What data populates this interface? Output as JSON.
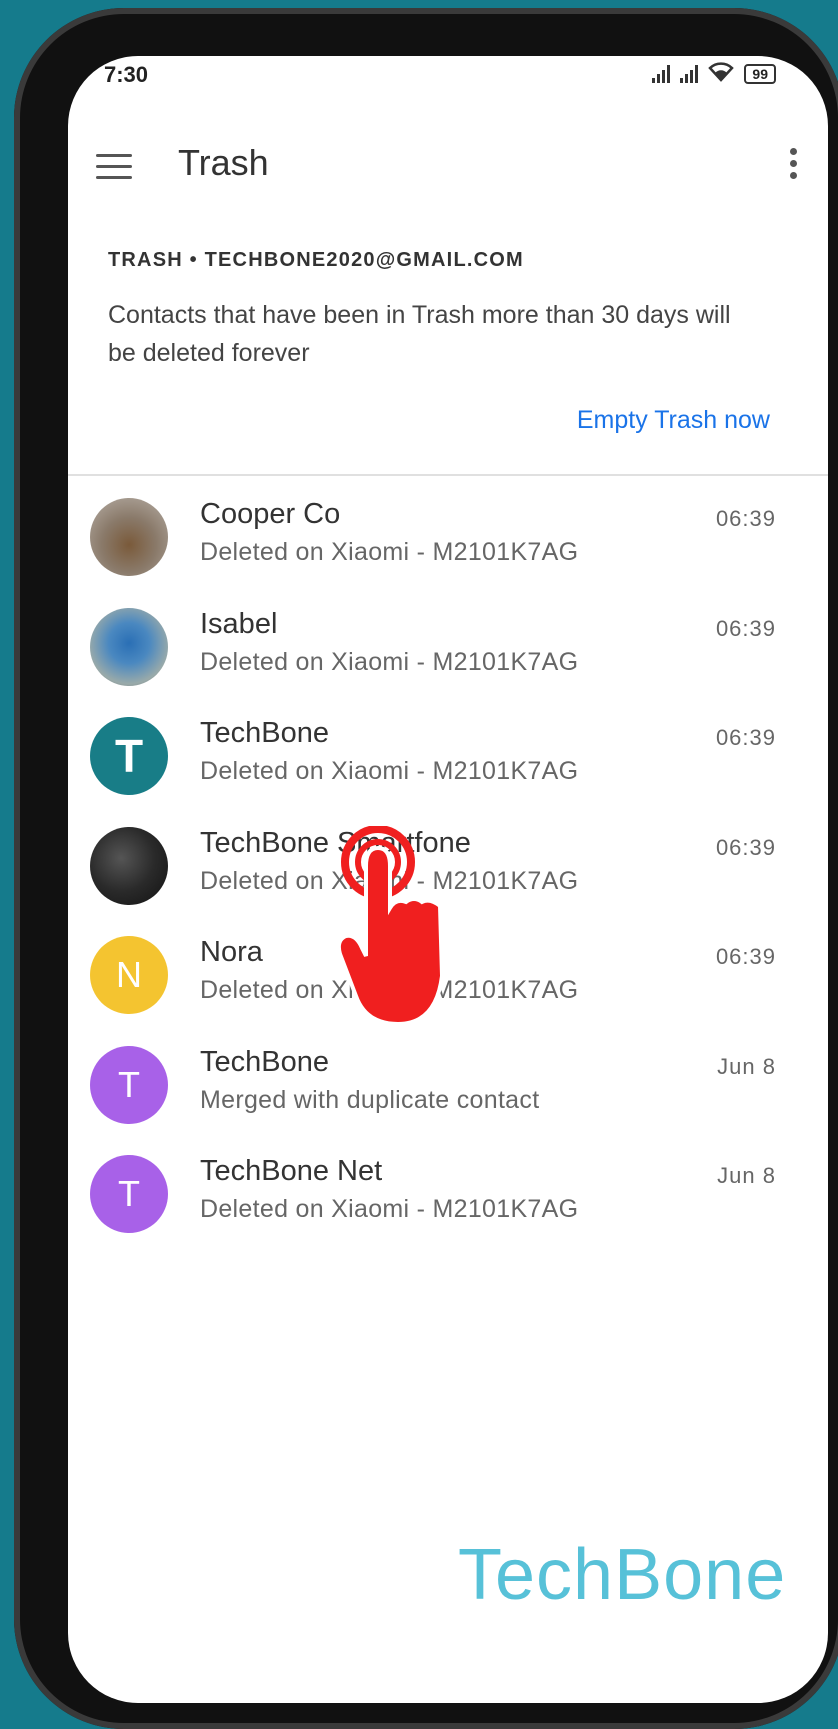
{
  "status_bar": {
    "time": "7:30",
    "battery": "99"
  },
  "app_bar": {
    "title": "Trash"
  },
  "account_label": "TRASH • TECHBONE2020@GMAIL.COM",
  "info_text": "Contacts that have been in Trash more than 30 days will be deleted forever",
  "empty_trash_label": "Empty Trash now",
  "contacts": [
    {
      "name": "Cooper Co",
      "subtitle": "Deleted on Xiaomi - M2101K7AG",
      "time": "06:39",
      "avatar_letter": "",
      "avatar_color": "#8a7a6a"
    },
    {
      "name": "Isabel",
      "subtitle": "Deleted on Xiaomi - M2101K7AG",
      "time": "06:39",
      "avatar_letter": "",
      "avatar_color": "#6b8fb0"
    },
    {
      "name": "TechBone",
      "subtitle": "Deleted on Xiaomi - M2101K7AG",
      "time": "06:39",
      "avatar_letter": "T",
      "avatar_color": "#187d87"
    },
    {
      "name": "TechBone Smartfone",
      "subtitle": "Deleted on Xiaomi - M2101K7AG",
      "time": "06:39",
      "avatar_letter": "",
      "avatar_color": "#2a2a2a"
    },
    {
      "name": "Nora",
      "subtitle": "Deleted on Xiaomi - M2101K7AG",
      "time": "06:39",
      "avatar_letter": "N",
      "avatar_color": "#f4c430"
    },
    {
      "name": "TechBone",
      "subtitle": "Merged with duplicate contact",
      "time": "Jun 8",
      "avatar_letter": "T",
      "avatar_color": "#a861e8"
    },
    {
      "name": "TechBone Net",
      "subtitle": "Deleted on Xiaomi - M2101K7AG",
      "time": "Jun 8",
      "avatar_letter": "T",
      "avatar_color": "#a861e8"
    }
  ],
  "watermark": "TechBone"
}
